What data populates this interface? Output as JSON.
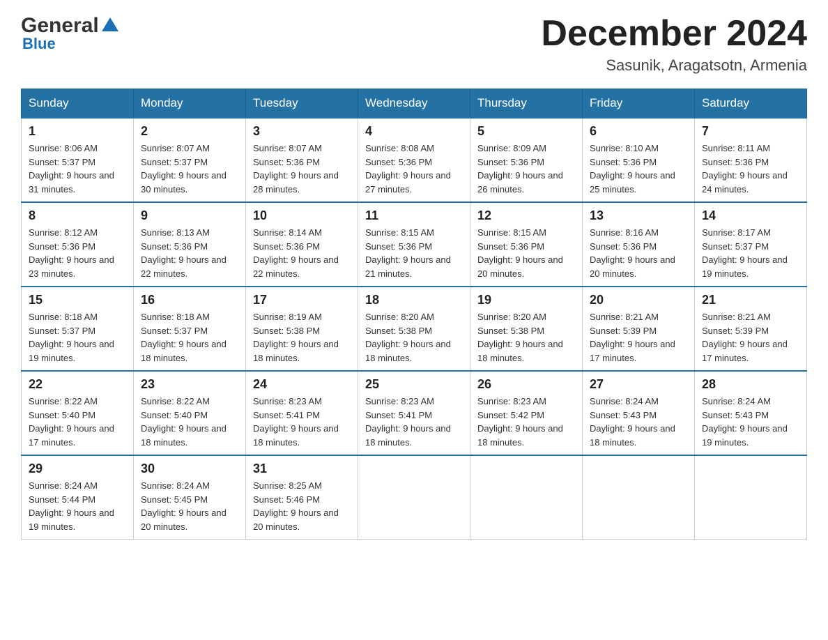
{
  "header": {
    "logo_main": "General",
    "logo_sub": "Blue",
    "title": "December 2024",
    "subtitle": "Sasunik, Aragatsotn, Armenia"
  },
  "days_of_week": [
    "Sunday",
    "Monday",
    "Tuesday",
    "Wednesday",
    "Thursday",
    "Friday",
    "Saturday"
  ],
  "weeks": [
    [
      {
        "day": "1",
        "sunrise": "8:06 AM",
        "sunset": "5:37 PM",
        "daylight": "9 hours and 31 minutes."
      },
      {
        "day": "2",
        "sunrise": "8:07 AM",
        "sunset": "5:37 PM",
        "daylight": "9 hours and 30 minutes."
      },
      {
        "day": "3",
        "sunrise": "8:07 AM",
        "sunset": "5:36 PM",
        "daylight": "9 hours and 28 minutes."
      },
      {
        "day": "4",
        "sunrise": "8:08 AM",
        "sunset": "5:36 PM",
        "daylight": "9 hours and 27 minutes."
      },
      {
        "day": "5",
        "sunrise": "8:09 AM",
        "sunset": "5:36 PM",
        "daylight": "9 hours and 26 minutes."
      },
      {
        "day": "6",
        "sunrise": "8:10 AM",
        "sunset": "5:36 PM",
        "daylight": "9 hours and 25 minutes."
      },
      {
        "day": "7",
        "sunrise": "8:11 AM",
        "sunset": "5:36 PM",
        "daylight": "9 hours and 24 minutes."
      }
    ],
    [
      {
        "day": "8",
        "sunrise": "8:12 AM",
        "sunset": "5:36 PM",
        "daylight": "9 hours and 23 minutes."
      },
      {
        "day": "9",
        "sunrise": "8:13 AM",
        "sunset": "5:36 PM",
        "daylight": "9 hours and 22 minutes."
      },
      {
        "day": "10",
        "sunrise": "8:14 AM",
        "sunset": "5:36 PM",
        "daylight": "9 hours and 22 minutes."
      },
      {
        "day": "11",
        "sunrise": "8:15 AM",
        "sunset": "5:36 PM",
        "daylight": "9 hours and 21 minutes."
      },
      {
        "day": "12",
        "sunrise": "8:15 AM",
        "sunset": "5:36 PM",
        "daylight": "9 hours and 20 minutes."
      },
      {
        "day": "13",
        "sunrise": "8:16 AM",
        "sunset": "5:36 PM",
        "daylight": "9 hours and 20 minutes."
      },
      {
        "day": "14",
        "sunrise": "8:17 AM",
        "sunset": "5:37 PM",
        "daylight": "9 hours and 19 minutes."
      }
    ],
    [
      {
        "day": "15",
        "sunrise": "8:18 AM",
        "sunset": "5:37 PM",
        "daylight": "9 hours and 19 minutes."
      },
      {
        "day": "16",
        "sunrise": "8:18 AM",
        "sunset": "5:37 PM",
        "daylight": "9 hours and 18 minutes."
      },
      {
        "day": "17",
        "sunrise": "8:19 AM",
        "sunset": "5:38 PM",
        "daylight": "9 hours and 18 minutes."
      },
      {
        "day": "18",
        "sunrise": "8:20 AM",
        "sunset": "5:38 PM",
        "daylight": "9 hours and 18 minutes."
      },
      {
        "day": "19",
        "sunrise": "8:20 AM",
        "sunset": "5:38 PM",
        "daylight": "9 hours and 18 minutes."
      },
      {
        "day": "20",
        "sunrise": "8:21 AM",
        "sunset": "5:39 PM",
        "daylight": "9 hours and 17 minutes."
      },
      {
        "day": "21",
        "sunrise": "8:21 AM",
        "sunset": "5:39 PM",
        "daylight": "9 hours and 17 minutes."
      }
    ],
    [
      {
        "day": "22",
        "sunrise": "8:22 AM",
        "sunset": "5:40 PM",
        "daylight": "9 hours and 17 minutes."
      },
      {
        "day": "23",
        "sunrise": "8:22 AM",
        "sunset": "5:40 PM",
        "daylight": "9 hours and 18 minutes."
      },
      {
        "day": "24",
        "sunrise": "8:23 AM",
        "sunset": "5:41 PM",
        "daylight": "9 hours and 18 minutes."
      },
      {
        "day": "25",
        "sunrise": "8:23 AM",
        "sunset": "5:41 PM",
        "daylight": "9 hours and 18 minutes."
      },
      {
        "day": "26",
        "sunrise": "8:23 AM",
        "sunset": "5:42 PM",
        "daylight": "9 hours and 18 minutes."
      },
      {
        "day": "27",
        "sunrise": "8:24 AM",
        "sunset": "5:43 PM",
        "daylight": "9 hours and 18 minutes."
      },
      {
        "day": "28",
        "sunrise": "8:24 AM",
        "sunset": "5:43 PM",
        "daylight": "9 hours and 19 minutes."
      }
    ],
    [
      {
        "day": "29",
        "sunrise": "8:24 AM",
        "sunset": "5:44 PM",
        "daylight": "9 hours and 19 minutes."
      },
      {
        "day": "30",
        "sunrise": "8:24 AM",
        "sunset": "5:45 PM",
        "daylight": "9 hours and 20 minutes."
      },
      {
        "day": "31",
        "sunrise": "8:25 AM",
        "sunset": "5:46 PM",
        "daylight": "9 hours and 20 minutes."
      },
      null,
      null,
      null,
      null
    ]
  ]
}
